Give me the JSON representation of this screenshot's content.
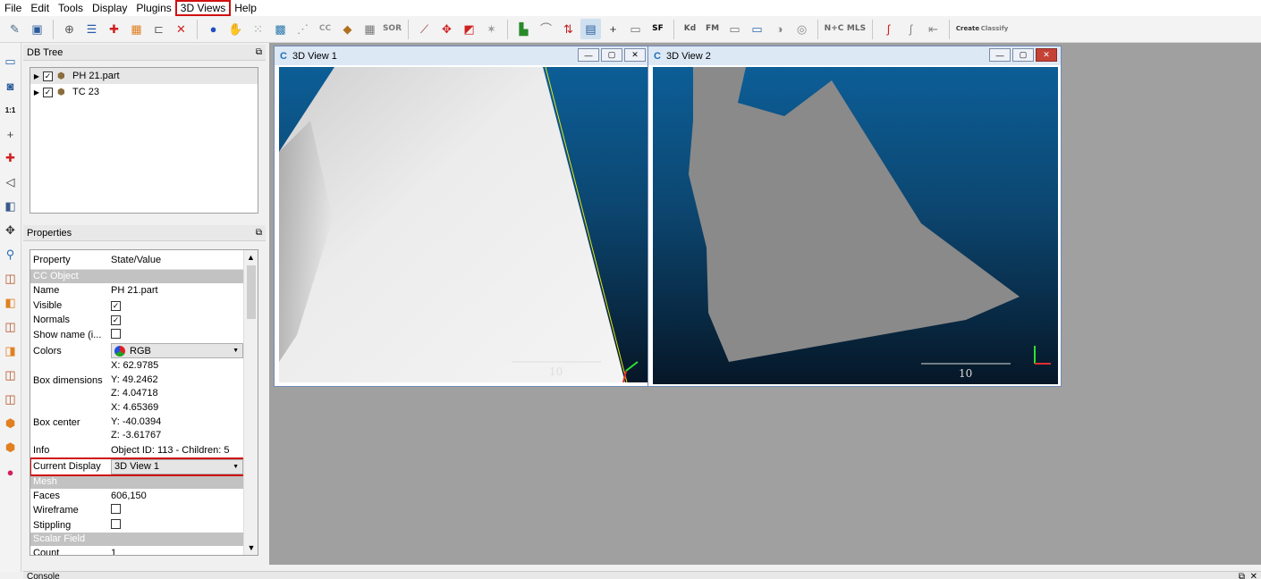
{
  "menu": [
    "File",
    "Edit",
    "Tools",
    "Display",
    "Plugins",
    "3D Views",
    "Help"
  ],
  "toolbar": {
    "icons": [
      "open-icon",
      "save-icon",
      "sep",
      "gear-target-icon",
      "list-icon",
      "crosshair-icon",
      "color-icon",
      "link-icon",
      "delete-icon",
      "sep",
      "sphere-icon",
      "hand-icon",
      "dots-icon",
      "grid-icon",
      "scatter-icon",
      "cc-icon",
      "chair-icon",
      "checker-icon",
      "sor-icon",
      "sep",
      "knife-icon",
      "move-icon",
      "plane-icon",
      "star-icon",
      "sep",
      "histogram-icon",
      "curve-icon",
      "minmax-icon",
      "table-icon",
      "plus-icon",
      "calc-icon",
      "sf-icon",
      "sep",
      "kd-icon",
      "fm-icon",
      "bp-icon",
      "csv-icon",
      "disc-icon",
      "globe-icon",
      "sep",
      "nc-icon",
      "mls-icon",
      "sep",
      "s-icon",
      "s2-icon",
      "export-icon",
      "sep",
      "canupo-create-icon",
      "canupo-classify-icon"
    ],
    "labels": {
      "sor": "SOR",
      "sf": "SF",
      "kd": "Kd",
      "fm": "FM",
      "nc": "N+C",
      "mls": "MLS",
      "cc": "CC",
      "canupo_create": "Create",
      "canupo_classify": "Classify"
    }
  },
  "dbtree": {
    "title": "DB Tree",
    "items": [
      {
        "label": "PH 21.part",
        "checked": "✓"
      },
      {
        "label": "TC 23",
        "checked": "✓"
      }
    ]
  },
  "properties": {
    "title": "Properties",
    "headers": {
      "property": "Property",
      "value": "State/Value"
    },
    "section_cc": "CC Object",
    "name_label": "Name",
    "name_value": "PH 21.part",
    "visible_label": "Visible",
    "normals_label": "Normals",
    "showname_label": "Show name (i...",
    "colors_label": "Colors",
    "colors_value": "RGB",
    "box_dim_label": "Box dimensions",
    "box_dim": [
      "X: 62.9785",
      "Y: 49.2462",
      "Z: 4.04718"
    ],
    "box_center_label": "Box center",
    "box_center": [
      "X: 4.65369",
      "Y: -40.0394",
      "Z: -3.61767"
    ],
    "info_label": "Info",
    "info_value": "Object ID: 113 - Children: 5",
    "current_display_label": "Current Display",
    "current_display_value": "3D View 1",
    "section_mesh": "Mesh",
    "faces_label": "Faces",
    "faces_value": "606,150",
    "wireframe_label": "Wireframe",
    "stippling_label": "Stippling",
    "section_sf": "Scalar Field",
    "partial_label": "Count",
    "partial_value": "1"
  },
  "view1": {
    "title": "3D View 1",
    "scale": "10"
  },
  "view2": {
    "title": "3D View 2",
    "scale": "10"
  },
  "console": {
    "title": "Console"
  },
  "colors": {
    "highlight": "#d01010",
    "viewport_top": "#0c5e97",
    "viewport_bottom": "#061727"
  }
}
